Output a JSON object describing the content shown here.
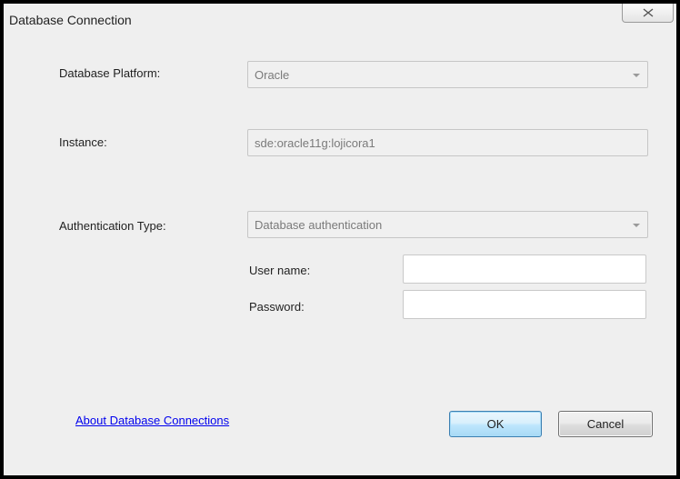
{
  "window": {
    "title": "Database Connection",
    "close_icon": "close-x-icon"
  },
  "form": {
    "platform_label": "Database Platform:",
    "platform_value": "Oracle",
    "instance_label": "Instance:",
    "instance_value": "sde:oracle11g:lojicora1",
    "auth_label": "Authentication Type:",
    "auth_value": "Database authentication",
    "username_label": "User name:",
    "username_value": "",
    "password_label": "Password:",
    "password_value": ""
  },
  "footer": {
    "about_link": "About Database Connections",
    "ok_label": "OK",
    "cancel_label": "Cancel"
  },
  "colors": {
    "link": "#0000ee",
    "ok_border": "#3c7fb1",
    "dialog_bg": "#efefef"
  }
}
